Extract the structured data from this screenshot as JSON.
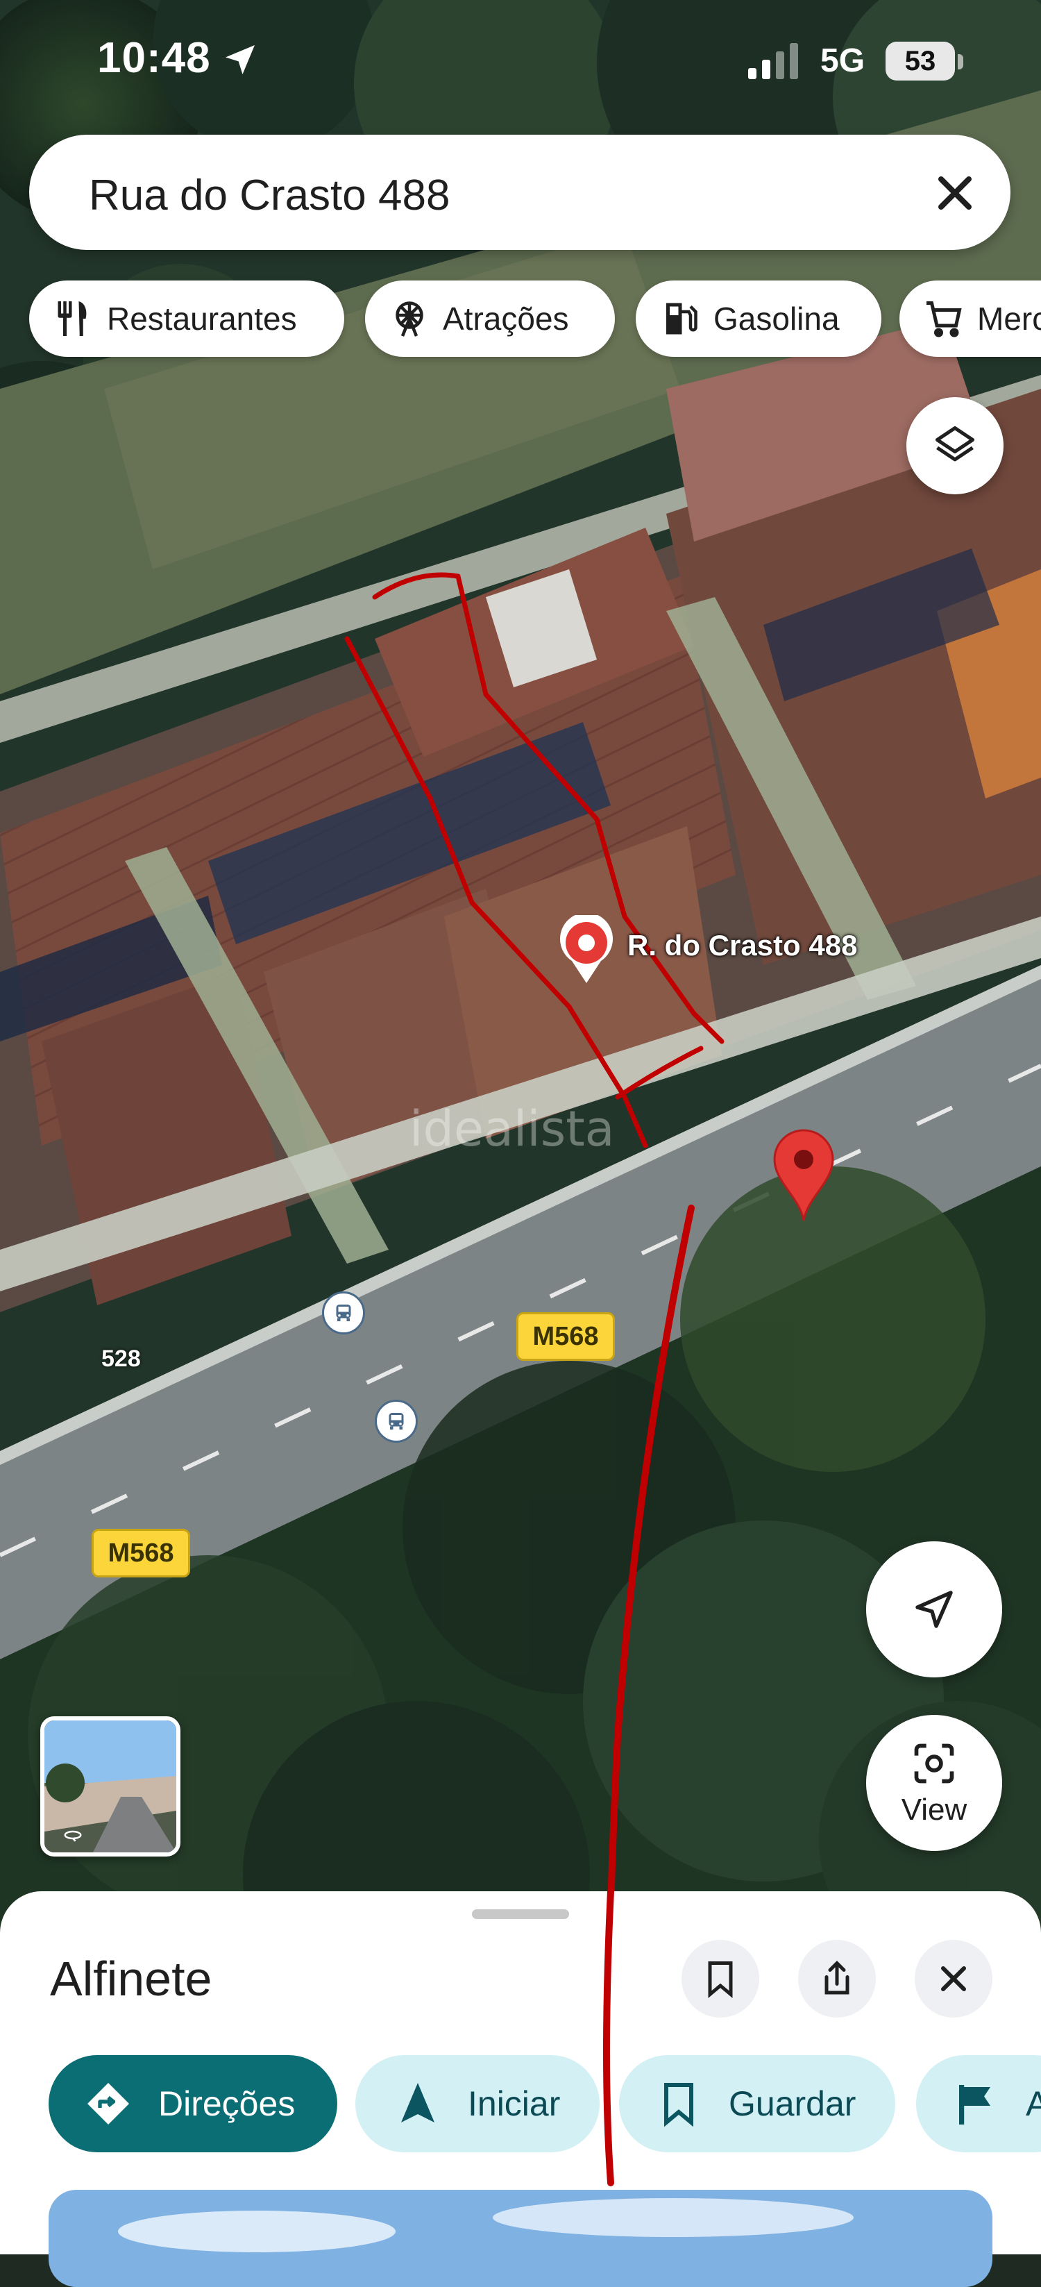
{
  "status_bar": {
    "time": "10:48",
    "network": "5G",
    "battery": "53"
  },
  "search": {
    "query": "Rua do Crasto 488"
  },
  "chips": [
    {
      "label": "Restaurantes",
      "icon": "fork-knife-icon"
    },
    {
      "label": "Atrações",
      "icon": "ferris-wheel-icon"
    },
    {
      "label": "Gasolina",
      "icon": "gas-pump-icon"
    },
    {
      "label": "Merc",
      "icon": "cart-icon"
    }
  ],
  "map": {
    "place_label": "R. do Crasto 488",
    "road_shields": [
      "M568",
      "M568"
    ],
    "house_number": "528",
    "watermark": "idealista",
    "colors": {
      "pin_red": "#e53935",
      "annotation_red": "#c00000",
      "shield_yellow": "#fbd53a"
    }
  },
  "buttons": {
    "view_label": "View"
  },
  "sheet": {
    "title": "Alfinete",
    "actions": [
      {
        "label": "Direções",
        "icon": "directions-icon",
        "primary": true
      },
      {
        "label": "Iniciar",
        "icon": "navigation-arrow-icon"
      },
      {
        "label": "Guardar",
        "icon": "bookmark-icon"
      },
      {
        "label": "A",
        "icon": "flag-icon"
      }
    ],
    "colors": {
      "primary": "#0b6e74",
      "secondary": "#d3f0f5"
    }
  }
}
